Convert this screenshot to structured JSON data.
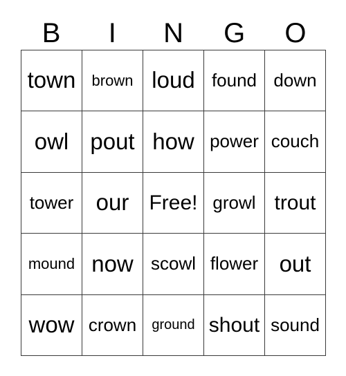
{
  "card": {
    "header_letters": [
      "B",
      "I",
      "N",
      "G",
      "O"
    ],
    "background_color": "#ffffff",
    "border_color": "#3a3a3a",
    "text_color": "#000000",
    "columns": 5,
    "rows": 5,
    "rows_data": [
      [
        {
          "text": "town",
          "size": "fs-xl"
        },
        {
          "text": "brown",
          "size": "fs-sm"
        },
        {
          "text": "loud",
          "size": "fs-xl"
        },
        {
          "text": "found",
          "size": "fs-md"
        },
        {
          "text": "down",
          "size": "fs-md"
        }
      ],
      [
        {
          "text": "owl",
          "size": "fs-xl"
        },
        {
          "text": "pout",
          "size": "fs-xl"
        },
        {
          "text": "how",
          "size": "fs-xl"
        },
        {
          "text": "power",
          "size": "fs-md"
        },
        {
          "text": "couch",
          "size": "fs-md"
        }
      ],
      [
        {
          "text": "tower",
          "size": "fs-md"
        },
        {
          "text": "our",
          "size": "fs-xl"
        },
        {
          "text": "Free!",
          "size": "fs-lg"
        },
        {
          "text": "growl",
          "size": "fs-md"
        },
        {
          "text": "trout",
          "size": "fs-lg"
        }
      ],
      [
        {
          "text": "mound",
          "size": "fs-sm"
        },
        {
          "text": "now",
          "size": "fs-xl"
        },
        {
          "text": "scowl",
          "size": "fs-md"
        },
        {
          "text": "flower",
          "size": "fs-md"
        },
        {
          "text": "out",
          "size": "fs-xl"
        }
      ],
      [
        {
          "text": "wow",
          "size": "fs-xl"
        },
        {
          "text": "crown",
          "size": "fs-md"
        },
        {
          "text": "ground",
          "size": "fs-xs"
        },
        {
          "text": "shout",
          "size": "fs-lg"
        },
        {
          "text": "sound",
          "size": "fs-md"
        }
      ]
    ]
  }
}
